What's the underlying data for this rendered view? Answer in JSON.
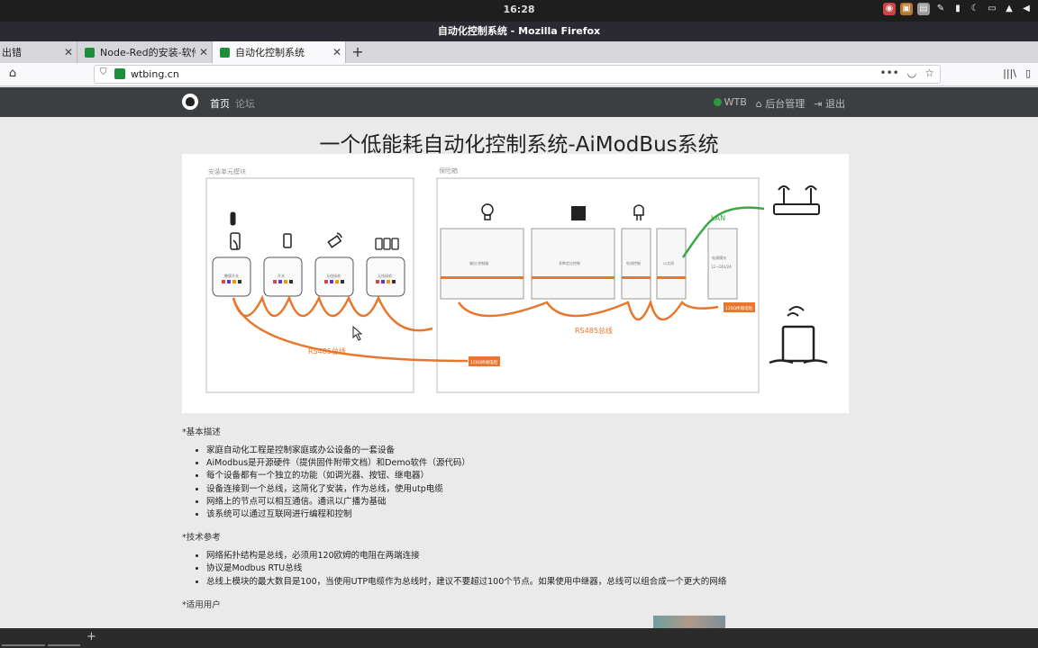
{
  "os": {
    "clock": "16:28"
  },
  "window": {
    "title": "自动化控制系统 - Mozilla Firefox"
  },
  "tabs": [
    {
      "label": "出错"
    },
    {
      "label": "Node-Red的安装-软件-自"
    },
    {
      "label": "自动化控制系统"
    }
  ],
  "url": "wtbing.cn",
  "site": {
    "nav_home": "首页",
    "nav_forum": "论坛",
    "user": "WTB",
    "admin": "后台管理",
    "logout": "退出"
  },
  "page_title": "一个低能耗自动化控制系统-AiModBus系统",
  "diagram": {
    "left_box_label": "安装单元模块",
    "right_box_label": "保险箱",
    "lan_label": "LAN",
    "bus_label_left": "RS485总线",
    "bus_label_right": "RS485总线",
    "terminator_label": "120Ω终端电阻",
    "module_labels": [
      "触摸开关",
      "开关",
      "无线接收",
      "无线接收"
    ],
    "rail_labels": [
      "输出·控制器",
      "多种定位控制",
      "电流控制",
      "以太网",
      "电源模块",
      "12~24V/2A"
    ]
  },
  "sections": [
    {
      "heading": "*基本描述",
      "items": [
        "家庭自动化工程是控制家庭或办公设备的一套设备",
        "AiModbus是开源硬件（提供固件附带文档）和Demo软件（源代码）",
        "每个设备都有一个独立的功能（如调光器、按钮、继电器）",
        "设备连接到一个总线，这简化了安装，作为总线，使用utp电缆",
        "网络上的节点可以相互通信。通讯以广播为基础",
        "该系统可以通过互联网进行编程和控制"
      ]
    },
    {
      "heading": "*技术参考",
      "items": [
        "网络拓扑结构是总线，必须用120欧姆的电阻在两端连接",
        "协议是Modbus RTU总线",
        "总线上模块的最大数目是100，当使用UTP电缆作为总线时，建议不要超过100个节点。如果使用中继器，总线可以组合成一个更大的网络"
      ]
    },
    {
      "heading": "*适用用户",
      "items": []
    }
  ],
  "colors": {
    "accent_orange": "#e8762c",
    "lan_green": "#3aa845",
    "header_dark": "#3c3f41"
  }
}
